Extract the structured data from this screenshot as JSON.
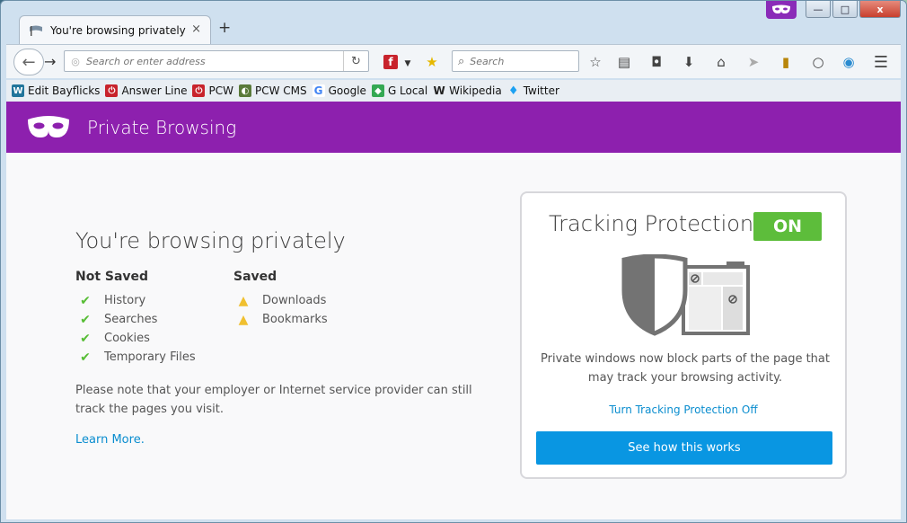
{
  "browser": {
    "tab_title": "You're browsing privately",
    "tab_close": "×",
    "new_tab": "+",
    "url_placeholder": "Search or enter address",
    "search_placeholder": "Search",
    "window_controls": {
      "minimize": "—",
      "maximize": "□",
      "close": "x"
    }
  },
  "bookmarks": [
    {
      "label": "Edit Bayflicks",
      "icon": "wordpress-icon",
      "color": "#21759b",
      "glyph": "W"
    },
    {
      "label": "Answer Line",
      "icon": "power-icon",
      "color": "#c8232c",
      "glyph": "⏻"
    },
    {
      "label": "PCW",
      "icon": "power-icon",
      "color": "#c8232c",
      "glyph": "⏻"
    },
    {
      "label": "PCW CMS",
      "icon": "drupal-icon",
      "color": "#5a7a3a",
      "glyph": "◐"
    },
    {
      "label": "Google",
      "icon": "google-icon",
      "color": "#4285f4",
      "glyph": "G"
    },
    {
      "label": "G Local",
      "icon": "maps-icon",
      "color": "#34a853",
      "glyph": "◆"
    },
    {
      "label": "Wikipedia",
      "icon": "wikipedia-icon",
      "color": "#222222",
      "glyph": "W"
    },
    {
      "label": "Twitter",
      "icon": "twitter-icon",
      "color": "#1da1f2",
      "glyph": "♦"
    }
  ],
  "header": {
    "title": "Private Browsing",
    "color": "#8d20ae"
  },
  "main": {
    "heading": "You're browsing privately",
    "not_saved": {
      "title": "Not Saved",
      "items": [
        "History",
        "Searches",
        "Cookies",
        "Temporary Files"
      ]
    },
    "saved": {
      "title": "Saved",
      "items": [
        "Downloads",
        "Bookmarks"
      ]
    },
    "note": "Please note that your employer or Internet service provider can still track the pages you visit.",
    "learn_more": "Learn More."
  },
  "tracking": {
    "title": "Tracking Protection",
    "status": "ON",
    "description": "Private windows now block parts of the page that may track your browsing activity.",
    "turn_off": "Turn Tracking Protection Off",
    "button": "See how this works",
    "colors": {
      "on": "#5dbd3b",
      "button": "#0996e2",
      "link": "#0a8dcf"
    }
  }
}
